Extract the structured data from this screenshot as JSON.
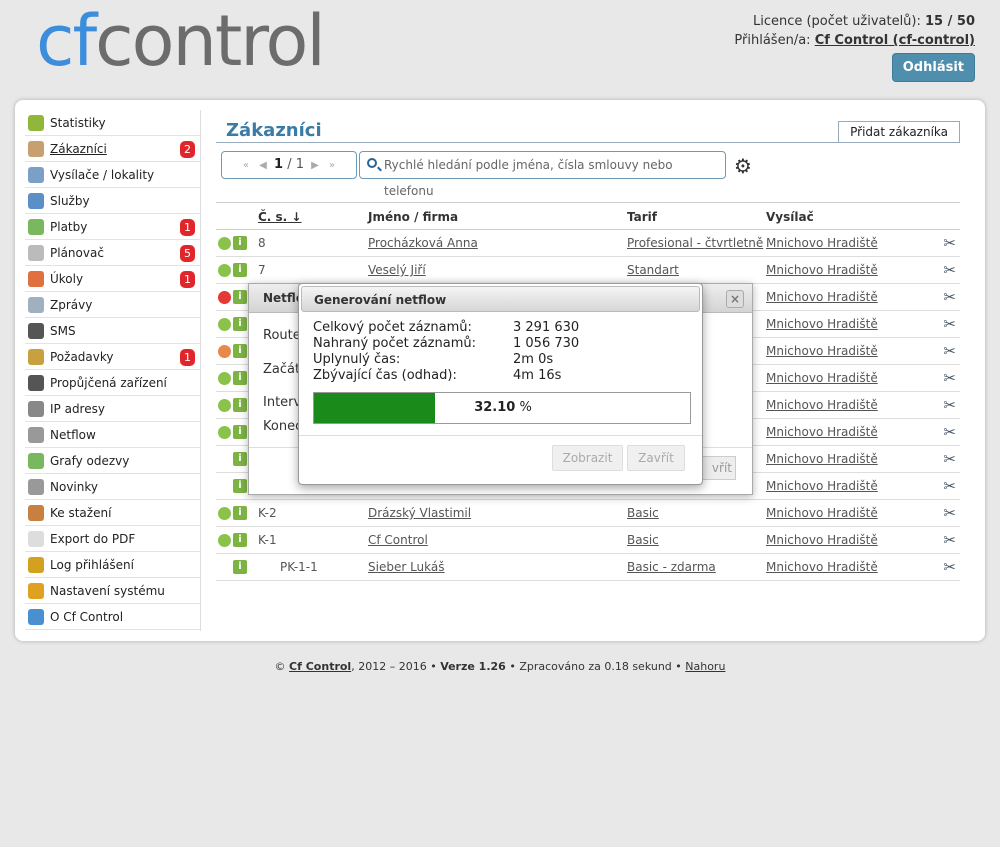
{
  "logo": {
    "cf": "cf",
    "control": "control"
  },
  "header": {
    "license_label": "Licence (počet uživatelů):",
    "license_value": "15 / 50",
    "logged_label": "Přihlášen/a:",
    "logged_user": "Cf Control (cf-control)",
    "logout": "Odhlásit"
  },
  "sidebar": {
    "items": [
      {
        "label": "Statistiky",
        "icon": "bar-chart-icon",
        "color": "#8fb83a",
        "badge": ""
      },
      {
        "label": "Zákazníci",
        "icon": "users-icon",
        "color": "#c8a070",
        "badge": "2"
      },
      {
        "label": "Vysílače / lokality",
        "icon": "antenna-icon",
        "color": "#7aa0c8",
        "badge": ""
      },
      {
        "label": "Služby",
        "icon": "cloud-icon",
        "color": "#5a8fc8",
        "badge": ""
      },
      {
        "label": "Platby",
        "icon": "money-icon",
        "color": "#7ab860",
        "badge": "1"
      },
      {
        "label": "Plánovač",
        "icon": "calendar-icon",
        "color": "#bbbbbb",
        "badge": "5"
      },
      {
        "label": "Úkoly",
        "icon": "lifebuoy-icon",
        "color": "#e07040",
        "badge": "1"
      },
      {
        "label": "Zprávy",
        "icon": "envelope-icon",
        "color": "#a0b0c0",
        "badge": ""
      },
      {
        "label": "SMS",
        "icon": "phone-icon",
        "color": "#555555",
        "badge": ""
      },
      {
        "label": "Požadavky",
        "icon": "clipboard-icon",
        "color": "#c8a040",
        "badge": "1"
      },
      {
        "label": "Propůjčená zařízení",
        "icon": "plug-icon",
        "color": "#555555",
        "badge": ""
      },
      {
        "label": "IP adresy",
        "icon": "ip-icon",
        "color": "#888888",
        "badge": ""
      },
      {
        "label": "Netflow",
        "icon": "netflow-icon",
        "color": "#999999",
        "badge": ""
      },
      {
        "label": "Grafy odezvy",
        "icon": "line-chart-icon",
        "color": "#7ab860",
        "badge": ""
      },
      {
        "label": "Novinky",
        "icon": "newspaper-icon",
        "color": "#999999",
        "badge": ""
      },
      {
        "label": "Ke stažení",
        "icon": "download-icon",
        "color": "#c88040",
        "badge": ""
      },
      {
        "label": "Export do PDF",
        "icon": "pdf-icon",
        "color": "#dddddd",
        "badge": ""
      },
      {
        "label": "Log přihlášení",
        "icon": "key-icon",
        "color": "#d4a020",
        "badge": ""
      },
      {
        "label": "Nastavení systému",
        "icon": "gear-icon",
        "color": "#e0a020",
        "badge": ""
      },
      {
        "label": "O Cf Control",
        "icon": "help-icon",
        "color": "#4a90d0",
        "badge": ""
      }
    ]
  },
  "main": {
    "title": "Zákazníci",
    "add_button": "Přidat zákazníka",
    "pager": {
      "first": "«",
      "prev": "◀",
      "page": "1",
      "sep": "/",
      "total": "1",
      "next": "▶",
      "last": "»"
    },
    "search_placeholder": "Rychlé hledání podle jména, čísla smlouvy nebo telefonu",
    "columns": {
      "cs": "Č. s.",
      "name": "Jméno / firma",
      "tarif": "Tarif",
      "vysilac": "Vysílač"
    },
    "rows": [
      {
        "status": "#8bc34a",
        "cs": "8",
        "name": "Procházková Anna",
        "tarif": "Profesional - čtvrtletně",
        "vysilac": "Mnichovo Hradiště"
      },
      {
        "status": "#8bc34a",
        "cs": "7",
        "name": "Veselý Jiří",
        "tarif": "Standart",
        "vysilac": "Mnichovo Hradiště"
      },
      {
        "status": "#e53935",
        "cs": "",
        "name": "",
        "tarif": "",
        "vysilac": "Mnichovo Hradiště"
      },
      {
        "status": "#8bc34a",
        "cs": "",
        "name": "",
        "tarif": "",
        "vysilac": "Mnichovo Hradiště"
      },
      {
        "status": "#e8884a",
        "cs": "",
        "name": "",
        "tarif": "",
        "vysilac": "Mnichovo Hradiště"
      },
      {
        "status": "#8bc34a",
        "cs": "",
        "name": "",
        "tarif": "",
        "vysilac": "Mnichovo Hradiště"
      },
      {
        "status": "#8bc34a",
        "cs": "",
        "name": "",
        "tarif": "",
        "vysilac": "Mnichovo Hradiště"
      },
      {
        "status": "#8bc34a",
        "cs": "",
        "name": "",
        "tarif": "",
        "vysilac": "Mnichovo Hradiště"
      },
      {
        "status": "",
        "cs": "",
        "name": "",
        "tarif": "",
        "vysilac": "Mnichovo Hradiště"
      },
      {
        "status": "",
        "cs": "",
        "name": "",
        "tarif": "",
        "vysilac": "Mnichovo Hradiště"
      },
      {
        "status": "#8bc34a",
        "cs": "K-2",
        "name": "Drázský Vlastimil",
        "tarif": "Basic",
        "vysilac": "Mnichovo Hradiště"
      },
      {
        "status": "#8bc34a",
        "cs": "K-1",
        "name": "Cf Control",
        "tarif": "Basic",
        "vysilac": "Mnichovo Hradiště"
      },
      {
        "status": "",
        "cs": "PK-1-1",
        "name": "Sieber Lukáš",
        "tarif": "Basic - zdarma",
        "vysilac": "Mnichovo Hradiště"
      }
    ]
  },
  "bg_modal": {
    "title": "Netflo",
    "labels": [
      "Route",
      "Začát",
      "Interv",
      "Konec"
    ],
    "button": "vřít"
  },
  "modal": {
    "title": "Generování netflow",
    "rows": [
      {
        "label": "Celkový počet záznamů:",
        "value": "3 291 630"
      },
      {
        "label": "Nahraný počet záznamů:",
        "value": "1 056 730"
      },
      {
        "label": "Uplynulý čas:",
        "value": "2m 0s"
      },
      {
        "label": "Zbývající čas (odhad):",
        "value": "4m 16s"
      }
    ],
    "progress": 32.1,
    "progress_value": "32.10",
    "progress_unit": "%",
    "show_button": "Zobrazit",
    "close_button": "Zavřít",
    "close_icon": "×"
  },
  "footer": {
    "copy": "©",
    "brand": "Cf Control",
    "years": ", 2012 – 2016 •",
    "version": "Verze 1.26",
    "processed": "• Zpracováno za 0.18 sekund •",
    "top": "Nahoru"
  }
}
